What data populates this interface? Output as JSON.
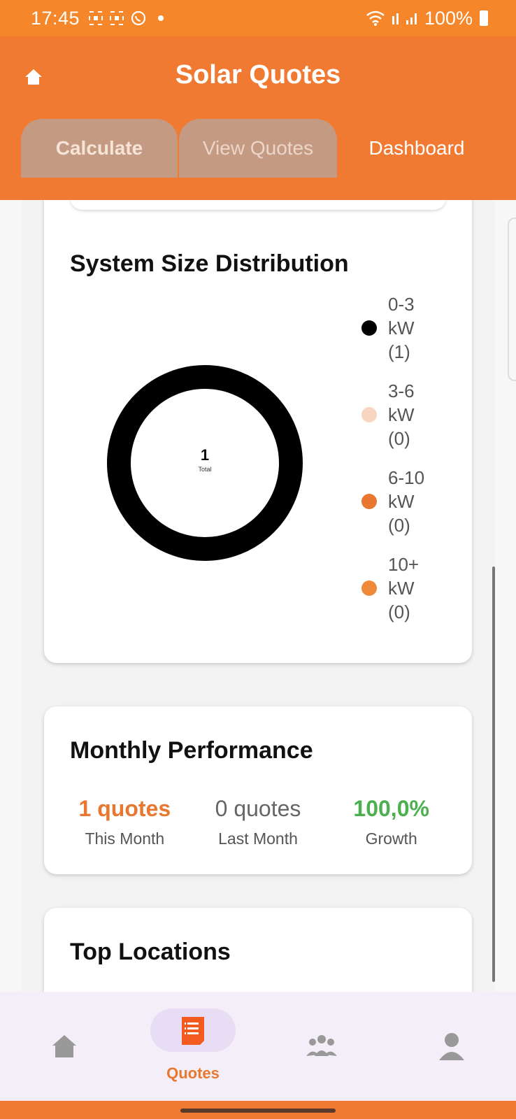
{
  "status_bar": {
    "time": "17:45",
    "left_icons": [
      "qr-scan-icon",
      "qr-scan-icon",
      "whatsapp-icon",
      "dot-icon"
    ],
    "battery": "100%"
  },
  "header": {
    "title": "Solar Quotes",
    "tabs": [
      {
        "label": "Calculate"
      },
      {
        "label": "View Quotes"
      },
      {
        "label": "Dashboard"
      }
    ],
    "active_tab": "Dashboard",
    "colors": {
      "header_bg": "#f07a32",
      "tab_bg": "#c59a82"
    }
  },
  "system_size": {
    "title": "System Size Distribution",
    "total_value": "1",
    "total_label": "Total",
    "legend": [
      {
        "label": "0-3 kW (1)",
        "color": "#000000"
      },
      {
        "label": "3-6 kW (0)",
        "color": "#f8d5c0"
      },
      {
        "label": "6-10 kW (0)",
        "color": "#e8772f"
      },
      {
        "label": "10+ kW (0)",
        "color": "#f08a3a"
      }
    ]
  },
  "chart_data": {
    "type": "pie",
    "categories": [
      "0-3 kW",
      "3-6 kW",
      "6-10 kW",
      "10+ kW"
    ],
    "values": [
      1,
      0,
      0,
      0
    ],
    "title": "System Size Distribution",
    "legend": "right"
  },
  "monthly": {
    "title": "Monthly Performance",
    "stats": [
      {
        "value": "1 quotes",
        "label": "This Month",
        "color": "#e8772f"
      },
      {
        "value": "0 quotes",
        "label": "Last Month",
        "color": "#666666"
      },
      {
        "value": "100,0%",
        "label": "Growth",
        "color": "#4caf50"
      }
    ]
  },
  "top_locations": {
    "title": "Top Locations"
  },
  "bottom_nav": {
    "items": [
      {
        "icon": "home-icon"
      },
      {
        "icon": "quotes-icon",
        "label": "Quotes",
        "active": true
      },
      {
        "icon": "users-group-icon"
      },
      {
        "icon": "person-icon"
      }
    ]
  }
}
